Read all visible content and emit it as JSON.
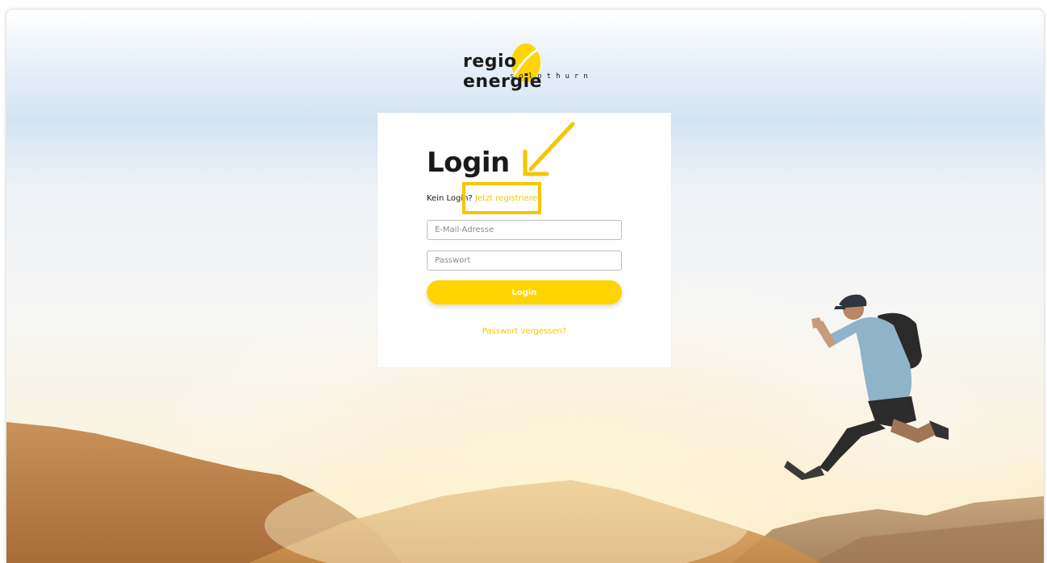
{
  "brand": {
    "name": "regio energie",
    "sub": "solothurn",
    "accent_color": "#ffd400"
  },
  "login": {
    "title": "Login",
    "no_login_text": "Kein Login?",
    "register_link": "Jetzt registrieren",
    "email_placeholder": "E-Mail-Adresse",
    "password_placeholder": "Passwort",
    "submit_label": "Login",
    "forgot_password": "Passwort vergessen?"
  },
  "icons": {
    "annotation_arrow": "arrow-down-left-icon",
    "annotation_box": "highlight-box"
  }
}
